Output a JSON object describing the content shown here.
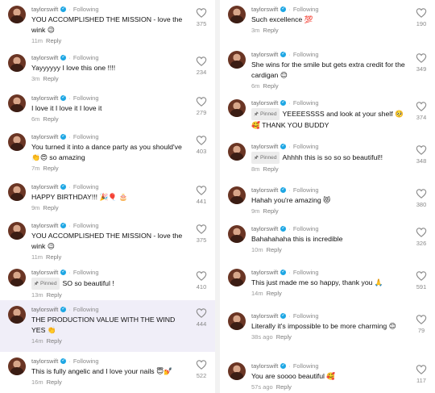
{
  "left_column": [
    {
      "user": "taylorswift",
      "status": "Following",
      "text": "YOU ACCOMPLISHED THE MISSION - love the wink 😉",
      "time": "11m",
      "reply": "Reply",
      "likes": "375",
      "pinned": ""
    },
    {
      "user": "taylorswift",
      "status": "Following",
      "text": "Yayyyyyy I love this one !!!!",
      "time": "3m",
      "reply": "Reply",
      "likes": "234",
      "pinned": ""
    },
    {
      "user": "taylorswift",
      "status": "Following",
      "text": "I love it I love it I love it",
      "time": "6m",
      "reply": "Reply",
      "likes": "279",
      "pinned": ""
    },
    {
      "user": "taylorswift",
      "status": "Following",
      "text": "You turned it into a dance party as you should've 👏😍 so amazing",
      "time": "7m",
      "reply": "Reply",
      "likes": "403",
      "pinned": ""
    },
    {
      "user": "taylorswift",
      "status": "Following",
      "text": "HAPPY BIRTHDAY!!! 🎉🎈 🎂",
      "time": "9m",
      "reply": "Reply",
      "likes": "441",
      "pinned": ""
    },
    {
      "user": "taylorswift",
      "status": "Following",
      "text": "YOU ACCOMPLISHED THE MISSION - love the wink 😉",
      "time": "11m",
      "reply": "Reply",
      "likes": "375",
      "pinned": ""
    },
    {
      "user": "taylorswift",
      "status": "Following",
      "text": "SO so beautiful !",
      "time": "13m",
      "reply": "Reply",
      "likes": "410",
      "pinned": "Pinned"
    },
    {
      "user": "taylorswift",
      "status": "Following",
      "text": "THE PRODUCTION VALUE WITH THE WIND YES 👏",
      "time": "14m",
      "reply": "Reply",
      "likes": "444",
      "pinned": ""
    },
    {
      "user": "taylorswift",
      "status": "Following",
      "text": "This is fully angelic and I love your nails 😇💅",
      "time": "16m",
      "reply": "Reply",
      "likes": "522",
      "pinned": ""
    }
  ],
  "right_column": [
    {
      "user": "taylorswift",
      "status": "Following",
      "text": "Such excellence 💯",
      "time": "3m",
      "reply": "Reply",
      "likes": "190",
      "pinned": ""
    },
    {
      "user": "taylorswift",
      "status": "Following",
      "text": "She wins for the smile but gets extra credit for the cardigan 😊",
      "time": "6m",
      "reply": "Reply",
      "likes": "349",
      "pinned": ""
    },
    {
      "user": "taylorswift",
      "status": "Following",
      "text": "YEEEESSSS and look at your shelf 🥺🥰 THANK YOU BUDDY",
      "time": "",
      "reply": "",
      "likes": "374",
      "pinned": "Pinned"
    },
    {
      "user": "taylorswift",
      "status": "Following",
      "text": "Ahhhh this is so so so beautiful!!",
      "time": "8m",
      "reply": "Reply",
      "likes": "348",
      "pinned": "Pinned"
    },
    {
      "user": "taylorswift",
      "status": "Following",
      "text": "Hahah you're amazing 😻",
      "time": "9m",
      "reply": "Reply",
      "likes": "380",
      "pinned": ""
    },
    {
      "user": "taylorswift",
      "status": "Following",
      "text": "Bahahahaha this is incredible",
      "time": "10m",
      "reply": "Reply",
      "likes": "326",
      "pinned": ""
    },
    {
      "user": "taylorswift",
      "status": "Following",
      "text": "This just made me so happy, thank you 🙏",
      "time": "14m",
      "reply": "Reply",
      "likes": "591",
      "pinned": ""
    },
    {
      "user": "taylorswift",
      "status": "Following",
      "text": "Literally it's impossible to be more charming 😊",
      "time": "38s ago",
      "reply": "Reply",
      "likes": "79",
      "pinned": ""
    },
    {
      "user": "taylorswift",
      "status": "Following",
      "text": "You are soooo beautiful 🥰",
      "time": "57s ago",
      "reply": "Reply",
      "likes": "117",
      "pinned": ""
    }
  ],
  "ui": {
    "verified_mark": "✓",
    "separator": "·",
    "pin_glyph": "🖈",
    "heart_icon": "heart-outline-icon",
    "highlight_color": "#f0eef8",
    "verified_color": "#1ea7e4"
  }
}
